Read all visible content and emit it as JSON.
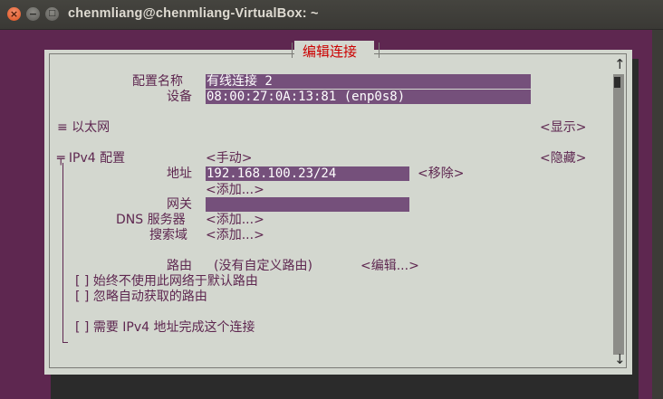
{
  "window": {
    "title": "chenmliang@chenmliang-VirtualBox: ~"
  },
  "dialog": {
    "title": "编辑连接",
    "profile_name_label": "配置名称",
    "profile_name_value": "有线连接 2",
    "device_label": "设备",
    "device_value": "08:00:27:0A:13:81 (enp0s8)",
    "ethernet_section": "≡ 以太网",
    "ethernet_toggle": "<显示>",
    "ipv4_section": "╤ IPv4 配置",
    "ipv4_method": "<手动>",
    "ipv4_toggle": "<隐藏>",
    "address_label": "地址",
    "address_value": "192.168.100.23/24",
    "remove_button": "<移除>",
    "add_address_button": "<添加...>",
    "gateway_label": "网关",
    "gateway_value": "",
    "dns_label": "DNS 服务器",
    "dns_add_button": "<添加...>",
    "search_label": "搜索域",
    "search_add_button": "<添加...>",
    "routes_label": "路由",
    "routes_value": "(没有自定义路由)",
    "routes_edit_button": "<编辑...>",
    "checkbox1": "[ ] 始终不使用此网络于默认路由",
    "checkbox2": "[ ] 忽略自动获取的路由",
    "checkbox3": "[ ] 需要 IPv4 地址完成这个连接"
  },
  "scrollbar": {
    "up": "↑",
    "down": "↓"
  },
  "colors": {
    "terminal_bg": "#5e2750",
    "dialog_bg": "#d3d7cf",
    "field_bg": "#75507b",
    "title_red": "#cc0000"
  }
}
